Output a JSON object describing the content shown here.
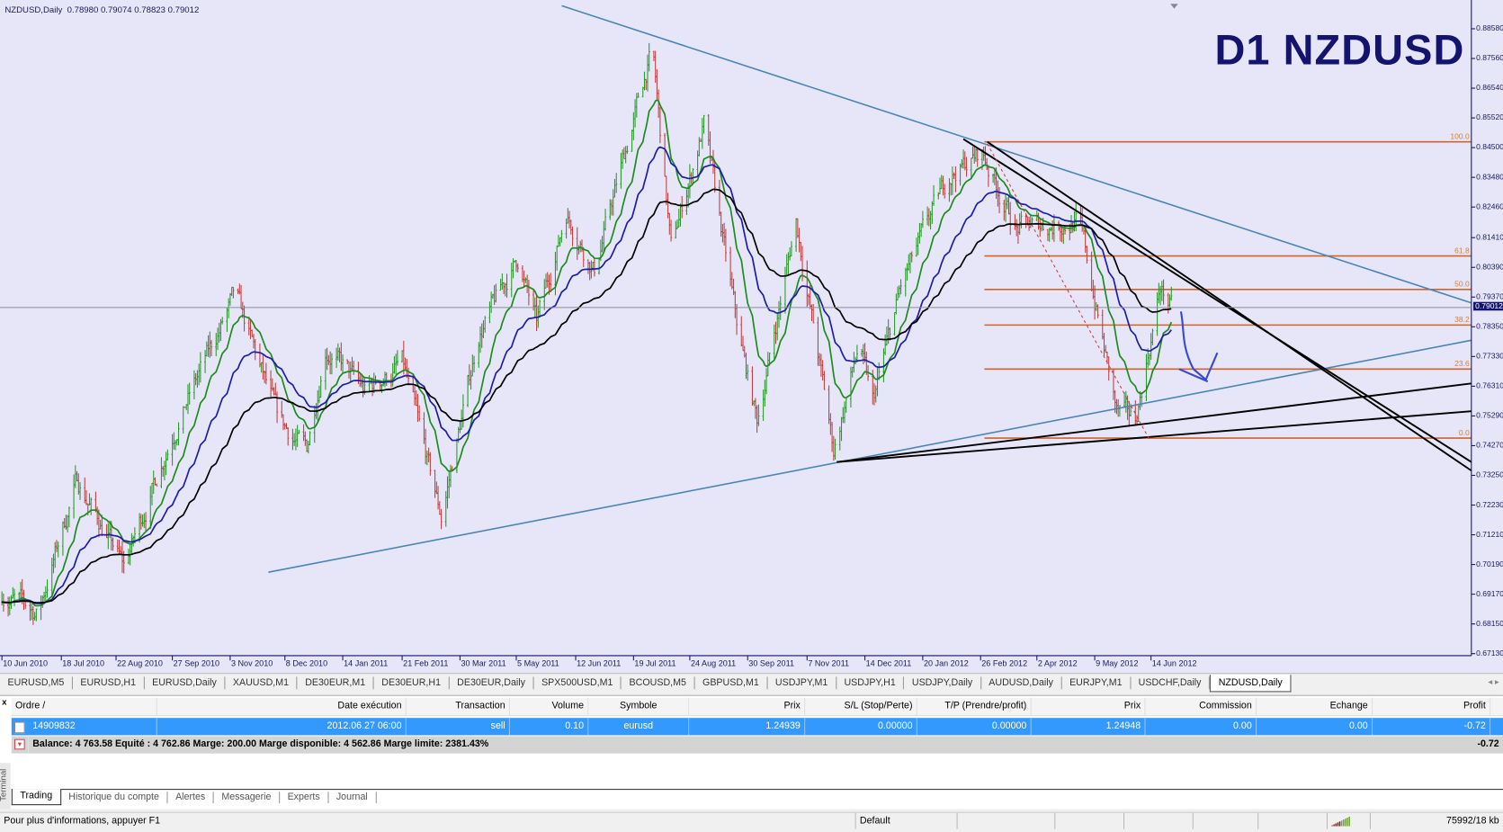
{
  "chart": {
    "info_symbol": "NZDUSD,Daily",
    "info_ohlc": "0.78980 0.79074 0.78823 0.79012",
    "overlay_title": "D1 NZDUSD",
    "current_price": "0.79012",
    "colors": {
      "background": "#e6e6f8",
      "bull": "#2a9a2a",
      "bear": "#c04040",
      "ema_fast": "#1e8c1e",
      "ema_mid": "#1e1eaa",
      "ema_slow": "#000000",
      "fib": "#d0642a",
      "trend_blue": "#4a86b4"
    }
  },
  "chart_data": {
    "type": "ohlc",
    "symbol": "NZDUSD",
    "timeframe": "Daily",
    "ylim": [
      0.6713,
      0.8858
    ],
    "y_ticks": [
      "0.88580",
      "0.87560",
      "0.86540",
      "0.85520",
      "0.84500",
      "0.83480",
      "0.82460",
      "0.81410",
      "0.80390",
      "0.79370",
      "0.78350",
      "0.77330",
      "0.76310",
      "0.75290",
      "0.74270",
      "0.73250",
      "0.72230",
      "0.71210",
      "0.70190",
      "0.69170",
      "0.68150",
      "0.67130"
    ],
    "x_ticks": [
      {
        "label": "10 Jun 2010",
        "date": "2010-06-10"
      },
      {
        "label": "18 Jul 2010",
        "date": "2010-07-18"
      },
      {
        "label": "22 Aug 2010",
        "date": "2010-08-22"
      },
      {
        "label": "27 Sep 2010",
        "date": "2010-09-27"
      },
      {
        "label": "3 Nov 2010",
        "date": "2010-11-03"
      },
      {
        "label": "8 Dec 2010",
        "date": "2010-12-08"
      },
      {
        "label": "14 Jan 2011",
        "date": "2011-01-14"
      },
      {
        "label": "21 Feb 2011",
        "date": "2011-02-21"
      },
      {
        "label": "30 Mar 2011",
        "date": "2011-03-30"
      },
      {
        "label": "5 May 2011",
        "date": "2011-05-05"
      },
      {
        "label": "12 Jun 2011",
        "date": "2011-06-12"
      },
      {
        "label": "19 Jul 2011",
        "date": "2011-07-19"
      },
      {
        "label": "24 Aug 2011",
        "date": "2011-08-24"
      },
      {
        "label": "30 Sep 2011",
        "date": "2011-09-30"
      },
      {
        "label": "7 Nov 2011",
        "date": "2011-11-07"
      },
      {
        "label": "14 Dec 2011",
        "date": "2011-12-14"
      },
      {
        "label": "20 Jan 2012",
        "date": "2012-01-20"
      },
      {
        "label": "26 Feb 2012",
        "date": "2012-02-26"
      },
      {
        "label": "2 Apr 2012",
        "date": "2012-04-02"
      },
      {
        "label": "9 May 2012",
        "date": "2012-05-09"
      },
      {
        "label": "14 Jun 2012",
        "date": "2012-06-14"
      }
    ],
    "close_path": [
      [
        "2010-06-10",
        0.692
      ],
      [
        "2010-07-03",
        0.685
      ],
      [
        "2010-07-28",
        0.731
      ],
      [
        "2010-08-27",
        0.701
      ],
      [
        "2010-09-27",
        0.747
      ],
      [
        "2010-11-06",
        0.794
      ],
      [
        "2010-12-04",
        0.751
      ],
      [
        "2010-12-22",
        0.741
      ],
      [
        "2011-01-03",
        0.777
      ],
      [
        "2011-01-28",
        0.761
      ],
      [
        "2011-02-21",
        0.771
      ],
      [
        "2011-03-18",
        0.718
      ],
      [
        "2011-04-11",
        0.781
      ],
      [
        "2011-05-06",
        0.807
      ],
      [
        "2011-05-18",
        0.784
      ],
      [
        "2011-06-06",
        0.823
      ],
      [
        "2011-06-24",
        0.803
      ],
      [
        "2011-07-31",
        0.879
      ],
      [
        "2011-08-12",
        0.81
      ],
      [
        "2011-09-02",
        0.853
      ],
      [
        "2011-09-24",
        0.781
      ],
      [
        "2011-10-06",
        0.751
      ],
      [
        "2011-10-31",
        0.82
      ],
      [
        "2011-11-24",
        0.741
      ],
      [
        "2011-12-10",
        0.777
      ],
      [
        "2011-12-19",
        0.757
      ],
      [
        "2012-01-06",
        0.797
      ],
      [
        "2012-02-06",
        0.836
      ],
      [
        "2012-02-27",
        0.843
      ],
      [
        "2012-03-20",
        0.817
      ],
      [
        "2012-04-29",
        0.82
      ],
      [
        "2012-05-23",
        0.754
      ],
      [
        "2012-06-04",
        0.751
      ],
      [
        "2012-06-20",
        0.797
      ],
      [
        "2012-06-27",
        0.7901
      ]
    ],
    "moving_averages": [
      {
        "name": "fast",
        "period": 15
      },
      {
        "name": "mid",
        "period": 35
      },
      {
        "name": "slow",
        "period": 70
      }
    ],
    "fibonacci": [
      {
        "label": "100.0",
        "price": 0.847
      },
      {
        "label": "61.8",
        "price": 0.8078
      },
      {
        "label": "50.0",
        "price": 0.7963
      },
      {
        "label": "38.2",
        "price": 0.7841
      },
      {
        "label": "23.6",
        "price": 0.769
      },
      {
        "label": "0.0",
        "price": 0.7453
      }
    ]
  },
  "symbol_tabs": [
    "EURUSD,M5",
    "EURUSD,H1",
    "EURUSD,Daily",
    "XAUUSD,M1",
    "DE30EUR,M1",
    "DE30EUR,H1",
    "DE30EUR,Daily",
    "SPX500USD,M1",
    "BCOUSD,M5",
    "GBPUSD,M1",
    "USDJPY,M1",
    "USDJPY,H1",
    "USDJPY,Daily",
    "AUDUSD,Daily",
    "EURJPY,M1",
    "USDCHF,Daily",
    "NZDUSD,Daily"
  ],
  "active_symbol_tab": "NZDUSD,Daily",
  "terminal": {
    "close": "x",
    "side_label": "Terminal",
    "columns": [
      "Ordre  /",
      "Date exécution",
      "Transaction",
      "Volume",
      "Symbole",
      "Prix",
      "S/L (Stop/Perte)",
      "T/P (Prendre/profit)",
      "Prix",
      "Commission",
      "Echange",
      "Profit"
    ],
    "orders": [
      [
        "14909832",
        "2012.06.27 06:00",
        "sell",
        "0.10",
        "eurusd",
        "1.24939",
        "0.00000",
        "0.00000",
        "1.24948",
        "0.00",
        "0.00",
        "-0.72"
      ]
    ],
    "balance_text": "Balance: 4 763.58  Equité : 4 762.86  Marge: 200.00  Marge disponible: 4 562.86  Marge limite: 2381.43%",
    "balance_profit": "-0.72",
    "tabs": [
      "Trading",
      "Historique du compte",
      "Alertes",
      "Messagerie",
      "Experts",
      "Journal"
    ],
    "active_tab": "Trading"
  },
  "status_bar": {
    "help": "Pour plus d'informations, appuyer F1",
    "profile": "Default",
    "traffic": "75992/18 kb"
  }
}
